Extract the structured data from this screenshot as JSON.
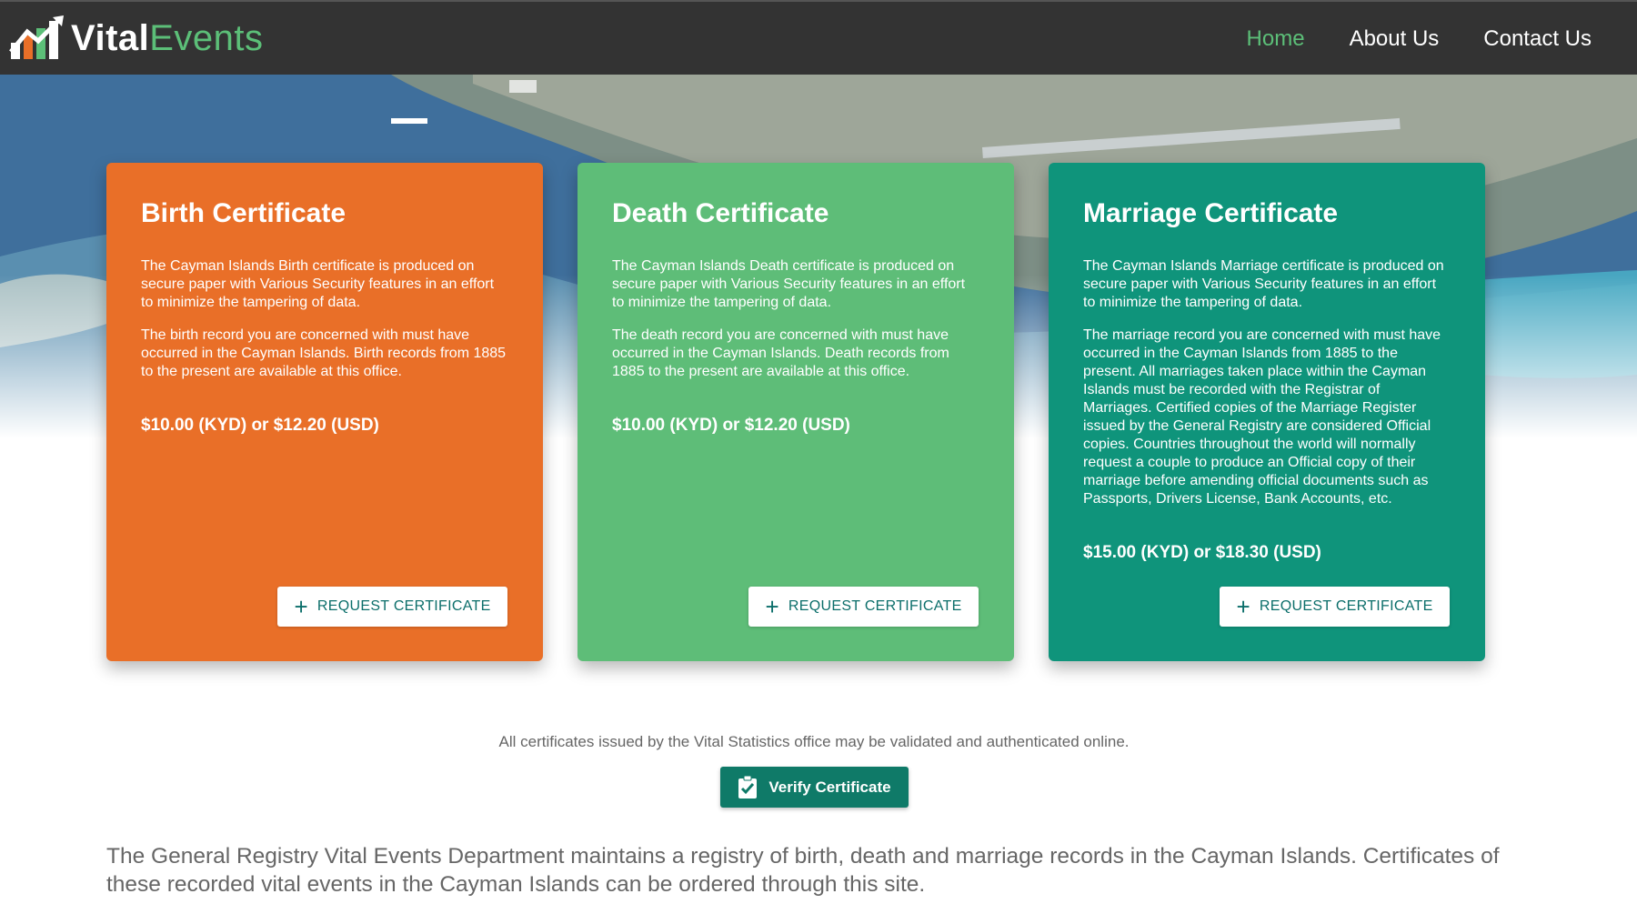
{
  "header": {
    "logo_vital": "Vital",
    "logo_events": "Events",
    "nav": [
      {
        "label": "Home",
        "active": true
      },
      {
        "label": "About Us",
        "active": false
      },
      {
        "label": "Contact Us",
        "active": false
      }
    ]
  },
  "cards": [
    {
      "title": "Birth Certificate",
      "p1": "The Cayman Islands Birth certificate is produced on secure paper with Various Security features in an effort to minimize the tampering of data.",
      "p2": "The birth record you are concerned with must have occurred in the Cayman Islands. Birth records from 1885 to the present are available at this office.",
      "price": "$10.00 (KYD) or $12.20 (USD)",
      "button": "REQUEST CERTIFICATE",
      "color": "#e96f28"
    },
    {
      "title": "Death Certificate",
      "p1": "The Cayman Islands Death certificate is produced on secure paper with Various Security features in an effort to minimize the tampering of data.",
      "p2": "The death record you are concerned with must have occurred in the Cayman Islands. Death records from 1885 to the present are available at this office.",
      "price": "$10.00 (KYD) or $12.20 (USD)",
      "button": "REQUEST CERTIFICATE",
      "color": "#5ebd78"
    },
    {
      "title": "Marriage Certificate",
      "p1": "The Cayman Islands Marriage certificate is produced on secure paper with Various Security features in an effort to minimize the tampering of data.",
      "p2": "The marriage record you are concerned with must have occurred in the Cayman Islands from 1885 to the present. All marriages taken place within the Cayman Islands must be recorded with the Registrar of Marriages. Certified copies of the Marriage Register issued by the General Registry are considered Official copies. Countries throughout the world will normally request a couple to produce an Official copy of their marriage before amending official documents such as Passports, Drivers License, Bank Accounts, etc.",
      "price": "$15.00 (KYD) or $18.30 (USD)",
      "button": "REQUEST CERTIFICATE",
      "color": "#0f947b"
    }
  ],
  "validation": {
    "text": "All certificates issued by the Vital Statistics office may be validated and authenticated online.",
    "button": "Verify Certificate"
  },
  "intro": "The General Registry Vital Events Department maintains a registry of birth, death and marriage records in the Cayman Islands. Certificates of these recorded vital events in the Cayman Islands can be ordered through this site.",
  "icons": {
    "logo": "bar-chart-arrow-logo",
    "request": "plus-icon",
    "verify": "clipboard-check-icon"
  }
}
